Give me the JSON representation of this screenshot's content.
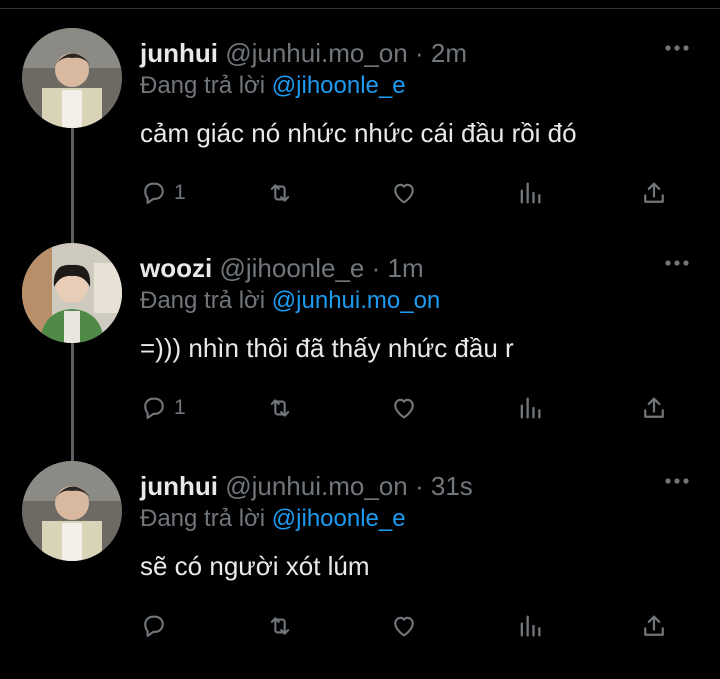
{
  "colors": {
    "background": "#000000",
    "text": "#e7e9ea",
    "muted": "#71767b",
    "accent": "#1d9bf0",
    "thread_line": "#5b5f63"
  },
  "tweets": [
    {
      "name": "junhui",
      "handle": "@junhui.mo_on",
      "dot": "·",
      "time": "2m",
      "reply_prefix": "Đang trả lời",
      "reply_to": "@jihoonle_e",
      "text": "cảm giác nó nhức nhức cái đầu rồi đó",
      "reply_count": "1",
      "avatar": "junhui-avatar"
    },
    {
      "name": "woozi",
      "handle": "@jihoonle_e",
      "dot": "·",
      "time": "1m",
      "reply_prefix": "Đang trả lời",
      "reply_to": "@junhui.mo_on",
      "text": "=))) nhìn thôi đã thấy nhức đầu r",
      "reply_count": "1",
      "avatar": "woozi-avatar"
    },
    {
      "name": "junhui",
      "handle": "@junhui.mo_on",
      "dot": "·",
      "time": "31s",
      "reply_prefix": "Đang trả lời",
      "reply_to": "@jihoonle_e",
      "text": "sẽ có người xót lúm",
      "reply_count": "",
      "avatar": "junhui-avatar"
    }
  ],
  "icons": [
    "reply-icon",
    "retweet-icon",
    "like-icon",
    "views-icon",
    "share-icon",
    "more-icon"
  ]
}
